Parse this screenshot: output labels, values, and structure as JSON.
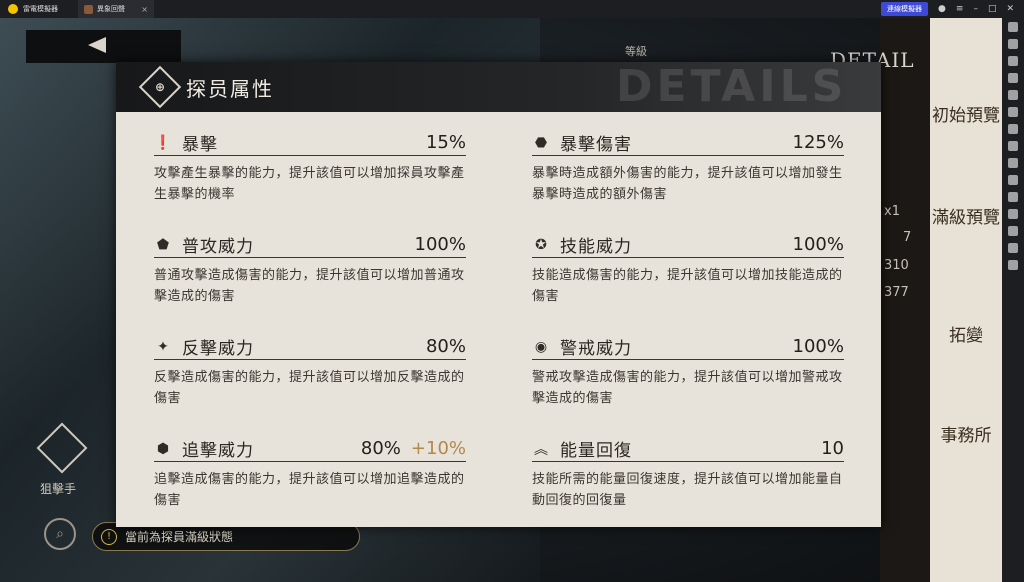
{
  "emulator": {
    "app_name": "雷電模擬器",
    "tab_title": "異象回聲",
    "tab_close": "×",
    "connect_label": "連線模擬器"
  },
  "background": {
    "level_label": "等級",
    "detail_text": "DETAIL",
    "sniper_label": "狙擊手",
    "status_text": "當前為探員滿級狀態",
    "right_strip": [
      "初始預覽",
      "滿級預覽",
      "拓變",
      "事務所"
    ],
    "stats": [
      "x1",
      "7",
      "310",
      "377"
    ]
  },
  "modal": {
    "title": "探员属性",
    "watermark": "DETAILS",
    "stats": [
      {
        "icon": "exclamation-icon",
        "name": "暴擊",
        "value": "15%",
        "bonus": "",
        "desc": "攻擊產生暴擊的能力，提升該值可以增加探員攻擊產生暴擊的機率"
      },
      {
        "icon": "crit-damage-icon",
        "name": "暴擊傷害",
        "value": "125%",
        "bonus": "",
        "desc": "暴擊時造成額外傷害的能力，提升該值可以增加發生暴擊時造成的額外傷害"
      },
      {
        "icon": "attack-power-icon",
        "name": "普攻威力",
        "value": "100%",
        "bonus": "",
        "desc": "普通攻擊造成傷害的能力，提升該值可以增加普通攻擊造成的傷害"
      },
      {
        "icon": "skill-power-icon",
        "name": "技能威力",
        "value": "100%",
        "bonus": "",
        "desc": "技能造成傷害的能力，提升該值可以增加技能造成的傷害"
      },
      {
        "icon": "counter-power-icon",
        "name": "反擊威力",
        "value": "80%",
        "bonus": "",
        "desc": "反擊造成傷害的能力，提升該值可以增加反擊造成的傷害"
      },
      {
        "icon": "alert-power-icon",
        "name": "警戒威力",
        "value": "100%",
        "bonus": "",
        "desc": "警戒攻擊造成傷害的能力，提升該值可以增加警戒攻擊造成的傷害"
      },
      {
        "icon": "pursuit-power-icon",
        "name": "追擊威力",
        "value": "80%",
        "bonus": "+10%",
        "desc": "追擊造成傷害的能力，提升該值可以增加追擊造成的傷害"
      },
      {
        "icon": "energy-regen-icon",
        "name": "能量回復",
        "value": "10",
        "bonus": "",
        "desc": "技能所需的能量回復速度，提升該值可以增加能量自動回復的回復量"
      }
    ]
  }
}
